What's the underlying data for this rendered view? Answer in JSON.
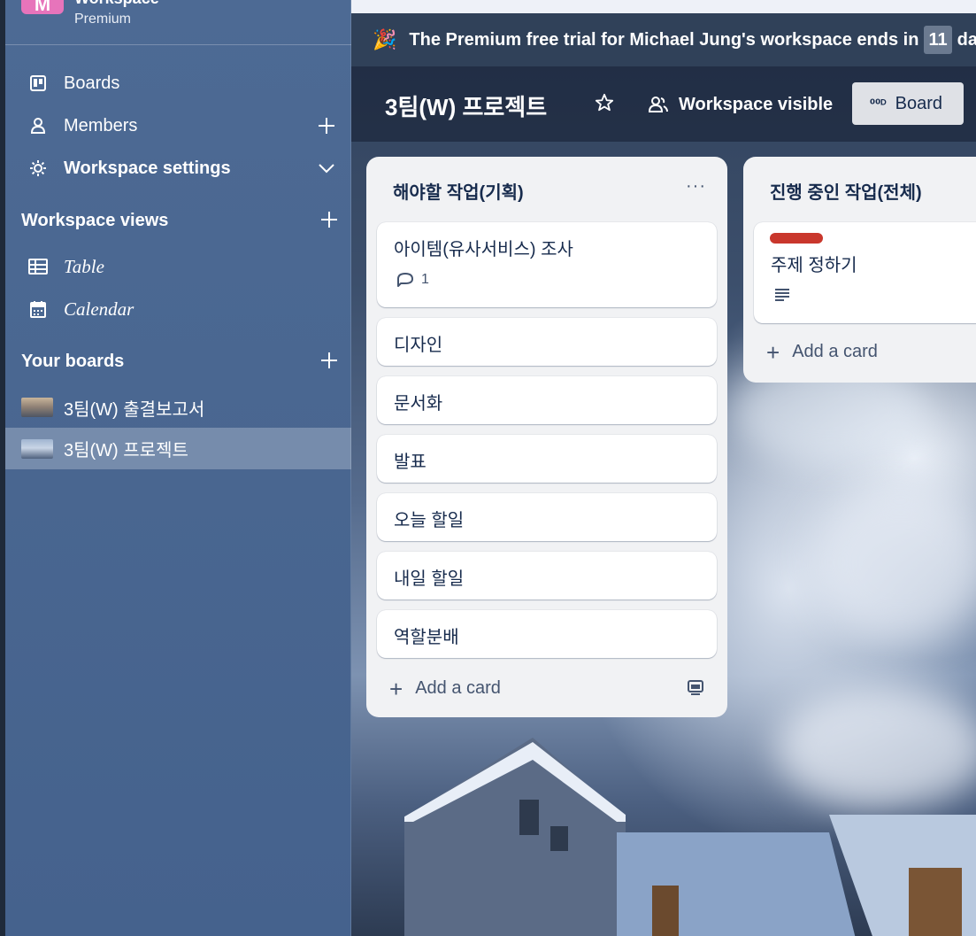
{
  "workspace": {
    "logo_letter": "M",
    "name": "Workspace",
    "plan": "Premium"
  },
  "sidebar": {
    "items": [
      {
        "label": "Boards",
        "icon": "board-icon"
      },
      {
        "label": "Members",
        "icon": "person-icon",
        "action": "plus-icon"
      },
      {
        "label": "Workspace settings",
        "icon": "gear-icon",
        "action": "chevron-down-icon"
      }
    ],
    "workspace_views_title": "Workspace views",
    "views": [
      {
        "label": "Table",
        "icon": "table-icon"
      },
      {
        "label": "Calendar",
        "icon": "calendar-icon"
      }
    ],
    "your_boards_title": "Your boards",
    "boards": [
      {
        "label": "3팀(W) 출결보고서"
      },
      {
        "label": "3팀(W) 프로젝트",
        "active": true
      }
    ]
  },
  "banner": {
    "text_before": "The Premium free trial for Michael Jung's workspace ends in",
    "days": "11",
    "text_after": "day"
  },
  "board": {
    "title": "3팀(W) 프로젝트",
    "visibility": "Workspace visible",
    "view_button": "Board"
  },
  "lists": [
    {
      "title": "해야할 작업(기획)",
      "menu": "···",
      "cards": [
        {
          "text": "아이템(유사서비스) 조사",
          "comments": "1"
        },
        {
          "text": "디자인"
        },
        {
          "text": "문서화"
        },
        {
          "text": "발표"
        },
        {
          "text": "오늘 할일"
        },
        {
          "text": "내일 할일"
        },
        {
          "text": "역할분배"
        }
      ],
      "add_card": "Add a card"
    },
    {
      "title": "진행 중인 작업(전체)",
      "cards": [
        {
          "text": "주제 정하기",
          "label_color": "#c9372c",
          "has_description": true
        }
      ],
      "add_card": "Add a card"
    }
  ],
  "colors": {
    "sidebar": "#4a6791",
    "banner": "#304159",
    "label_red": "#c9372c",
    "logo": "#e774bb"
  }
}
